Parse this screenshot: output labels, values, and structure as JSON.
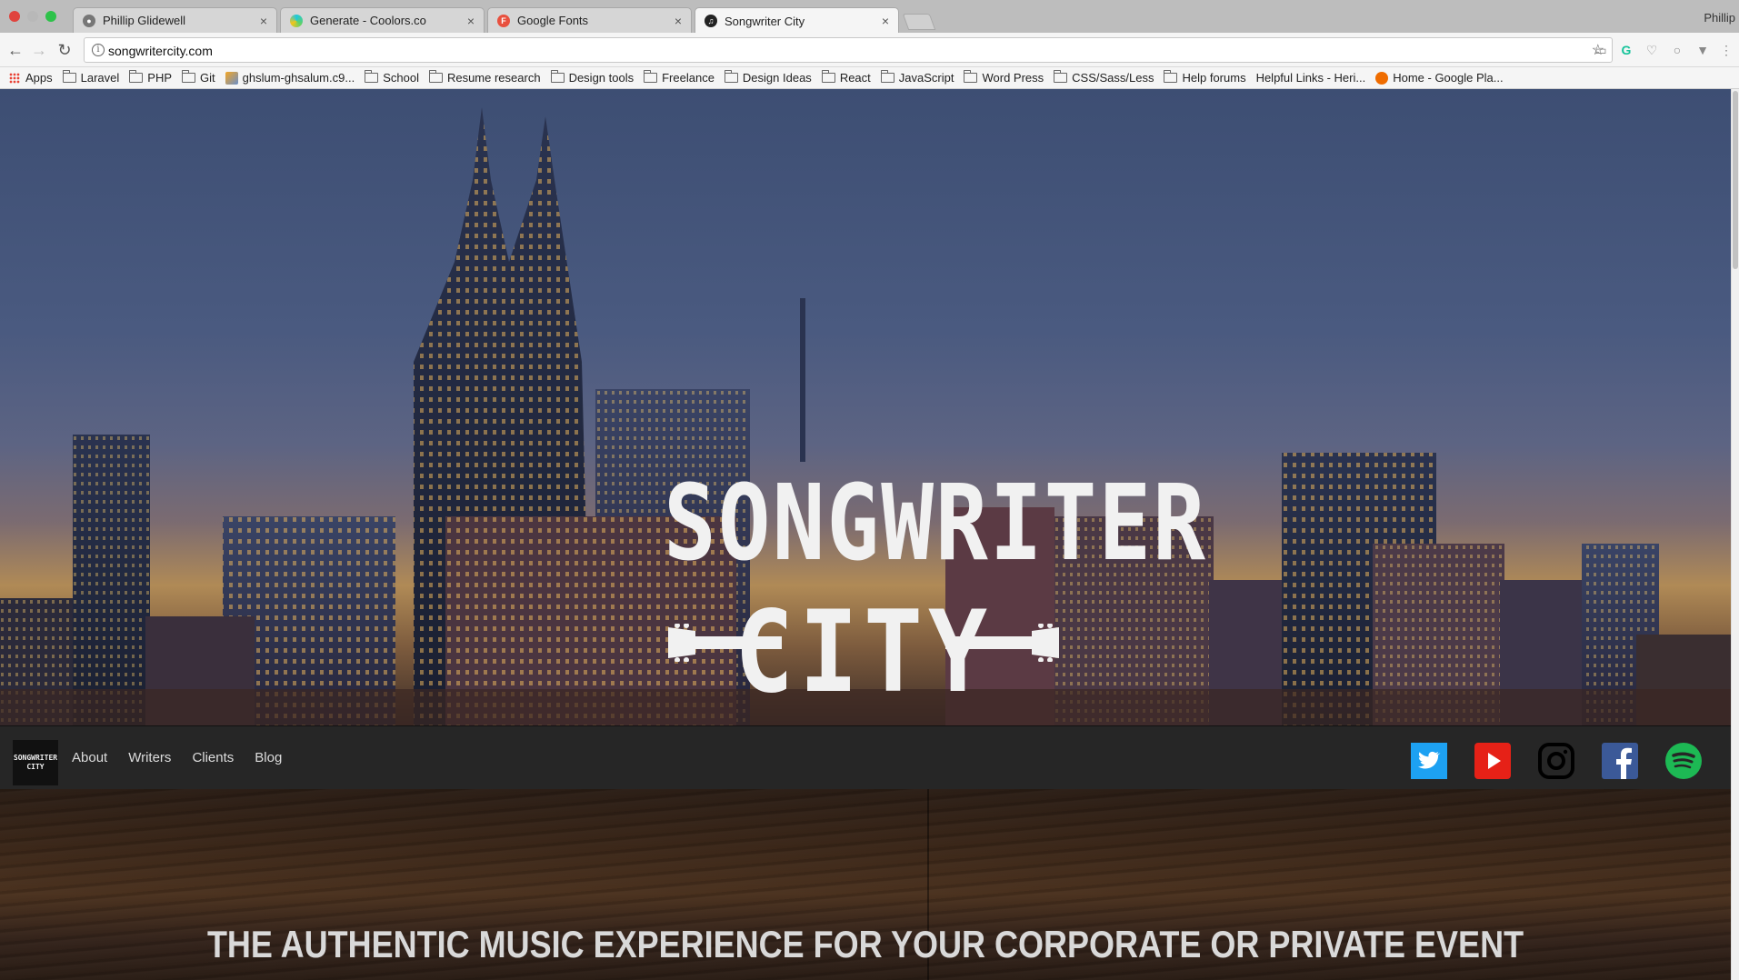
{
  "browser": {
    "tabs": [
      {
        "label": "Phillip Glidewell",
        "favicon": "github-icon",
        "active": false
      },
      {
        "label": "Generate - Coolors.co",
        "favicon": "coolors-icon",
        "active": false
      },
      {
        "label": "Google Fonts",
        "favicon": "google-fonts-icon",
        "active": false
      },
      {
        "label": "Songwriter City",
        "favicon": "songwriter-city-icon",
        "active": true
      }
    ],
    "profile_name": "Phillip",
    "url": "songwritercity.com",
    "bookmarks": [
      {
        "label": "Apps",
        "icon": "apps-grid-icon"
      },
      {
        "label": "Laravel",
        "icon": "folder-icon"
      },
      {
        "label": "PHP",
        "icon": "folder-icon"
      },
      {
        "label": "Git",
        "icon": "folder-icon"
      },
      {
        "label": "ghslum-ghsalum.c9...",
        "icon": "phpmyadmin-icon"
      },
      {
        "label": "School",
        "icon": "folder-icon"
      },
      {
        "label": "Resume research",
        "icon": "folder-icon"
      },
      {
        "label": "Design tools",
        "icon": "folder-icon"
      },
      {
        "label": "Freelance",
        "icon": "folder-icon"
      },
      {
        "label": "Design Ideas",
        "icon": "folder-icon"
      },
      {
        "label": "React",
        "icon": "folder-icon"
      },
      {
        "label": "JavaScript",
        "icon": "folder-icon"
      },
      {
        "label": "Word Press",
        "icon": "folder-icon"
      },
      {
        "label": "CSS/Sass/Less",
        "icon": "folder-icon"
      },
      {
        "label": "Help forums",
        "icon": "folder-icon"
      },
      {
        "label": "Helpful Links - Heri...",
        "icon": "page-icon"
      },
      {
        "label": "Home - Google Pla...",
        "icon": "google-play-music-icon"
      }
    ]
  },
  "site": {
    "logo_line1": "SONGWRITER",
    "logo_line2": "CITY",
    "nav_logo_line1": "SONGWRITER",
    "nav_logo_line2": "CITY",
    "nav": [
      "About",
      "Writers",
      "Clients",
      "Blog"
    ],
    "social": [
      {
        "name": "twitter-icon",
        "color": "#1da1f2"
      },
      {
        "name": "youtube-icon",
        "color": "#e62117"
      },
      {
        "name": "instagram-icon",
        "color": "#000000"
      },
      {
        "name": "facebook-icon",
        "color": "#3b5998"
      },
      {
        "name": "spotify-icon",
        "color": "#1db954"
      }
    ],
    "tagline": "THE AUTHENTIC MUSIC EXPERIENCE FOR YOUR CORPORATE OR PRIVATE EVENT"
  }
}
